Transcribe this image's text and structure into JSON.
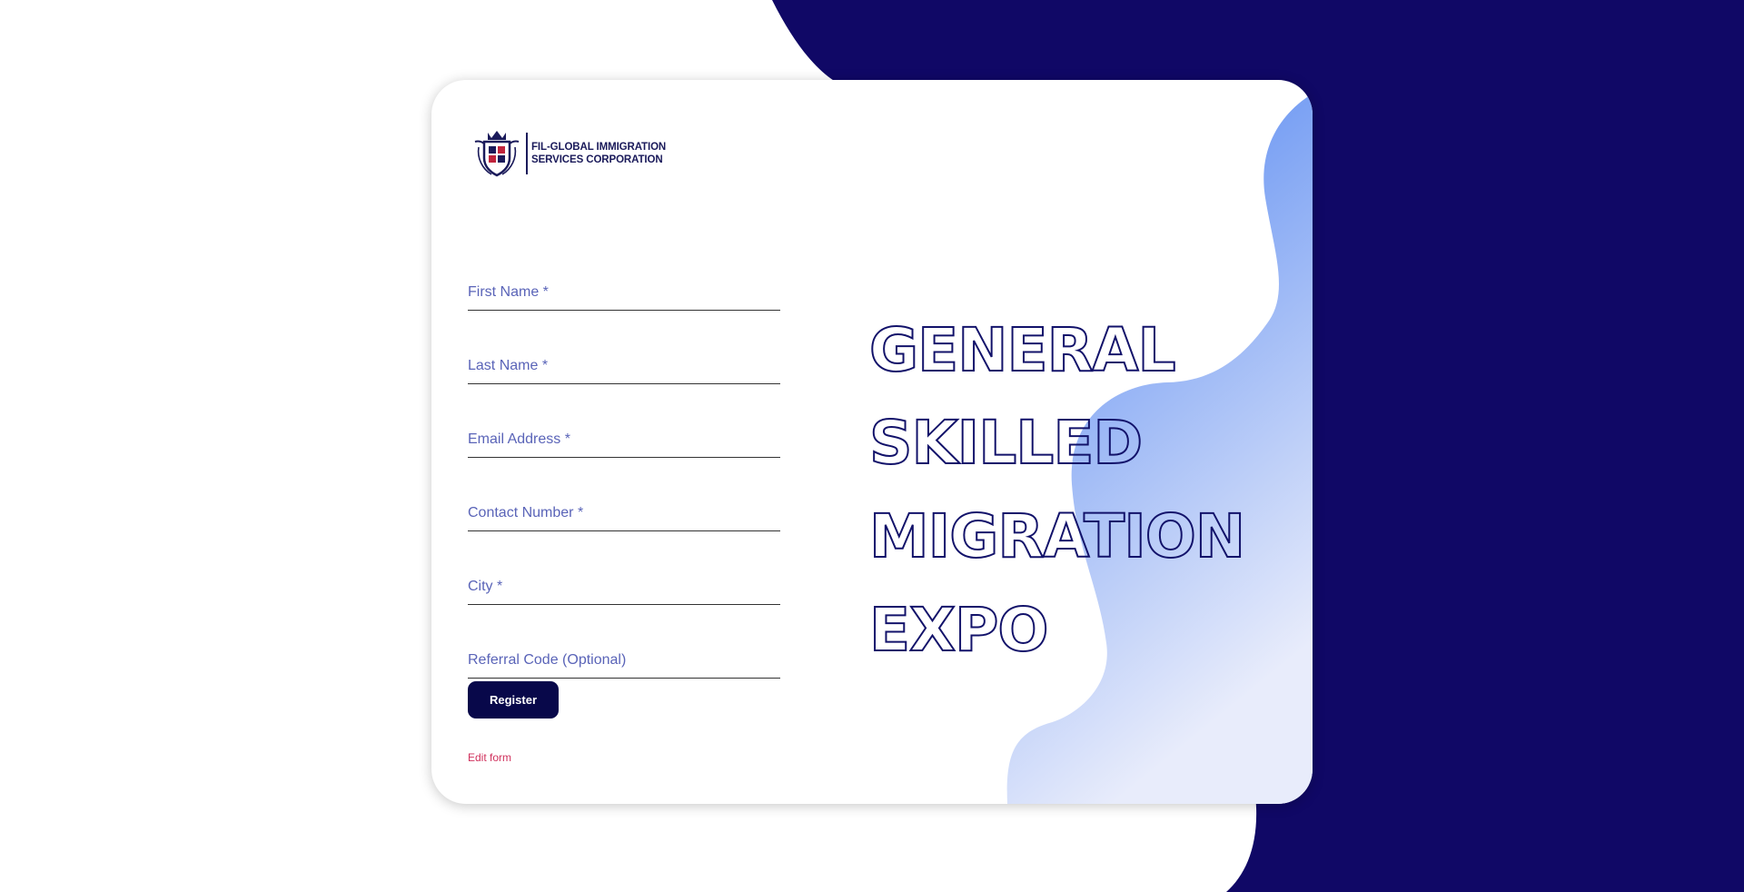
{
  "colors": {
    "navy": "#100866",
    "button": "#08084a",
    "blue_gradient_top": "#4a80f0",
    "blue_gradient_bottom": "#e8ecfb",
    "label": "#5a64b8",
    "edit_link": "#d0305c"
  },
  "logo": {
    "icon": "crest-icon",
    "line1": "FIL-GLOBAL IMMIGRATION",
    "line2": "SERVICES CORPORATION"
  },
  "form": {
    "fields": [
      {
        "placeholder": "First Name *",
        "value": ""
      },
      {
        "placeholder": "Last Name *",
        "value": ""
      },
      {
        "placeholder": "Email Address *",
        "value": ""
      },
      {
        "placeholder": "Contact Number *",
        "value": ""
      },
      {
        "placeholder": "City *",
        "value": ""
      },
      {
        "placeholder": "Referral Code (Optional)",
        "value": ""
      }
    ],
    "submit_label": "Register",
    "edit_link": "Edit form"
  },
  "headline": {
    "line1": "GENERAL",
    "line2": "SKILLED",
    "line3": "MIGRATION",
    "line4": "EXPO"
  }
}
